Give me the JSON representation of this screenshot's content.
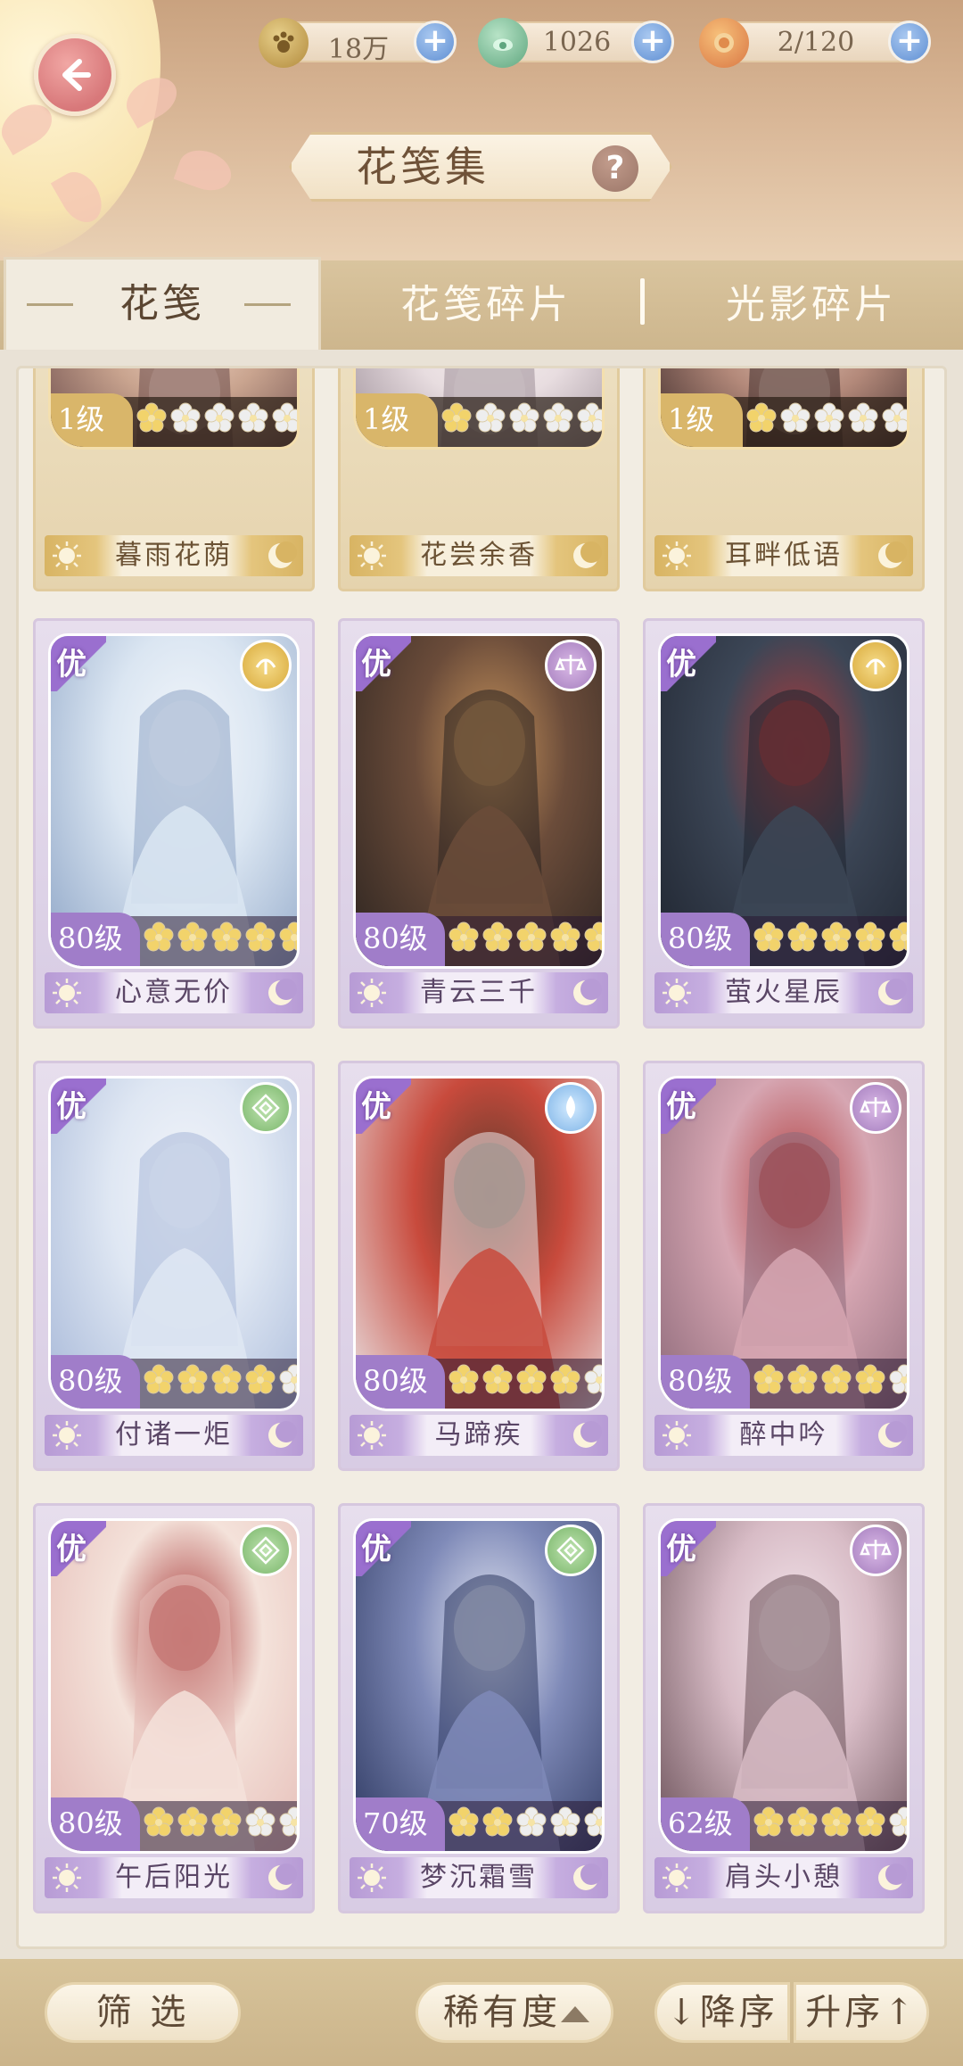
{
  "header": {
    "title": "花笺集",
    "help_label": "?",
    "resources": [
      {
        "name": "coins",
        "value": "18万",
        "icon": "paw-coin-icon"
      },
      {
        "name": "jade",
        "value": "1026",
        "icon": "jade-icon"
      },
      {
        "name": "stamina",
        "value": "2/120",
        "icon": "mooncake-icon"
      }
    ],
    "plus_label": "+"
  },
  "tabs": [
    {
      "label": "花笺",
      "active": true
    },
    {
      "label": "花笺碎片",
      "active": false
    },
    {
      "label": "光影碎片",
      "active": false
    }
  ],
  "cards": [
    {
      "name": "暮雨花荫",
      "level": "1级",
      "stars_filled": 1,
      "style": "gold",
      "rank": "",
      "attribute": "",
      "palette": [
        "#6a4a4a",
        "#c9a48f",
        "#f0d2c0"
      ]
    },
    {
      "name": "花尝余香",
      "level": "1级",
      "stars_filled": 1,
      "style": "gold",
      "rank": "",
      "attribute": "",
      "palette": [
        "#9c8e98",
        "#e8dde0",
        "#f7f0ee"
      ]
    },
    {
      "name": "耳畔低语",
      "level": "1级",
      "stars_filled": 1,
      "style": "gold",
      "rank": "",
      "attribute": "",
      "palette": [
        "#3d2a2a",
        "#b3897a",
        "#e0bfae"
      ]
    },
    {
      "name": "心意无价",
      "level": "80级",
      "stars_filled": 5,
      "style": "purple",
      "rank": "优",
      "attribute": "gold",
      "palette": [
        "#8fa6c7",
        "#dbe6f2",
        "#f4f7fb"
      ]
    },
    {
      "name": "青云三千",
      "level": "80级",
      "stars_filled": 5,
      "style": "purple",
      "rank": "优",
      "attribute": "scale",
      "palette": [
        "#2c2420",
        "#6b4c3a",
        "#c9955d"
      ]
    },
    {
      "name": "萤火星辰",
      "level": "80级",
      "stars_filled": 5,
      "style": "purple",
      "rank": "优",
      "attribute": "gold",
      "palette": [
        "#1f2530",
        "#3c4656",
        "#b23a3a"
      ]
    },
    {
      "name": "付诸一炬",
      "level": "80级",
      "stars_filled": 4,
      "style": "purple",
      "rank": "优",
      "attribute": "green",
      "palette": [
        "#a7b8d8",
        "#dfe7f3",
        "#f3f5fa"
      ]
    },
    {
      "name": "马蹄疾",
      "level": "80级",
      "stars_filled": 4,
      "style": "purple",
      "rank": "优",
      "attribute": "blue",
      "palette": [
        "#e9e4e6",
        "#c84a3c",
        "#5a3a2c"
      ]
    },
    {
      "name": "醉中吟",
      "level": "80级",
      "stars_filled": 4,
      "style": "purple",
      "rank": "优",
      "attribute": "scale",
      "palette": [
        "#8e6a7a",
        "#d6a6b2",
        "#b03a3a"
      ]
    },
    {
      "name": "午后阳光",
      "level": "80级",
      "stars_filled": 3,
      "style": "purple",
      "rank": "优",
      "attribute": "green",
      "palette": [
        "#e4b9b4",
        "#f4e2da",
        "#a32d2d"
      ]
    },
    {
      "name": "梦沉霜雪",
      "level": "70级",
      "stars_filled": 2,
      "style": "purple",
      "rank": "优",
      "attribute": "green",
      "palette": [
        "#2d3860",
        "#7f8ab8",
        "#e6e9f4"
      ]
    },
    {
      "name": "肩头小憩",
      "level": "62级",
      "stars_filled": 4,
      "style": "purple",
      "rank": "优",
      "attribute": "scale",
      "palette": [
        "#6a5058",
        "#d8bcc6",
        "#f4e6ec"
      ]
    }
  ],
  "bottom": {
    "filter_label": "筛 选",
    "sort_label": "稀有度",
    "desc_label": "↓降序",
    "asc_label": "升序↑"
  },
  "colors": {
    "accent_purple": "#a07dc9",
    "accent_gold": "#d9b66a",
    "star_filled": "#f2d36b",
    "star_empty": "#eeeeee"
  }
}
